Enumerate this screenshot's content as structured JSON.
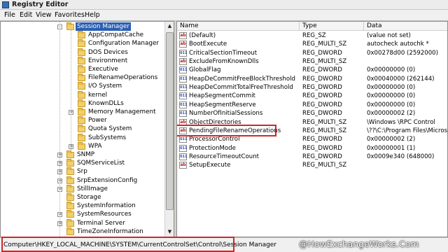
{
  "window": {
    "title": "Registry Editor"
  },
  "menu": [
    "File",
    "Edit",
    "View",
    "Favorites",
    "Help"
  ],
  "tree": {
    "items": [
      {
        "label": "Session Manager",
        "selected": true,
        "expander": "-"
      },
      {
        "label": "AppCompatCache"
      },
      {
        "label": "Configuration Manager"
      },
      {
        "label": "DOS Devices"
      },
      {
        "label": "Environment"
      },
      {
        "label": "Executive"
      },
      {
        "label": "FileRenameOperations"
      },
      {
        "label": "I/O System"
      },
      {
        "label": "kernel"
      },
      {
        "label": "KnownDLLs"
      },
      {
        "label": "Memory Management",
        "expander": "+"
      },
      {
        "label": "Power"
      },
      {
        "label": "Quota System"
      },
      {
        "label": "SubSystems"
      },
      {
        "label": "WPA",
        "expander": "+"
      },
      {
        "label": "SNMP",
        "expander": "+"
      },
      {
        "label": "SQMServiceList",
        "expander": "+"
      },
      {
        "label": "Srp",
        "expander": "+"
      },
      {
        "label": "SrpExtensionConfig",
        "expander": "+"
      },
      {
        "label": "StillImage",
        "expander": "+"
      },
      {
        "label": "Storage"
      },
      {
        "label": "SystemInformation"
      },
      {
        "label": "SystemResources",
        "expander": "+"
      },
      {
        "label": "Terminal Server",
        "expander": "+"
      },
      {
        "label": "TimeZoneInformation"
      }
    ]
  },
  "list": {
    "columns": [
      "Name",
      "Type",
      "Data"
    ],
    "rows": [
      {
        "icon": "sz",
        "name": "(Default)",
        "type": "REG_SZ",
        "data": "(value not set)"
      },
      {
        "icon": "sz",
        "name": "BootExecute",
        "type": "REG_MULTI_SZ",
        "data": "autocheck autochk *"
      },
      {
        "icon": "dw",
        "name": "CriticalSectionTimeout",
        "type": "REG_DWORD",
        "data": "0x00278d00 (2592000)"
      },
      {
        "icon": "sz",
        "name": "ExcludeFromKnownDlls",
        "type": "REG_MULTI_SZ",
        "data": ""
      },
      {
        "icon": "dw",
        "name": "GlobalFlag",
        "type": "REG_DWORD",
        "data": "0x00000000 (0)"
      },
      {
        "icon": "dw",
        "name": "HeapDeCommitFreeBlockThreshold",
        "type": "REG_DWORD",
        "data": "0x00040000 (262144)"
      },
      {
        "icon": "dw",
        "name": "HeapDeCommitTotalFreeThreshold",
        "type": "REG_DWORD",
        "data": "0x00000000 (0)"
      },
      {
        "icon": "dw",
        "name": "HeapSegmentCommit",
        "type": "REG_DWORD",
        "data": "0x00000000 (0)"
      },
      {
        "icon": "dw",
        "name": "HeapSegmentReserve",
        "type": "REG_DWORD",
        "data": "0x00000000 (0)"
      },
      {
        "icon": "dw",
        "name": "NumberOfInitialSessions",
        "type": "REG_DWORD",
        "data": "0x00000002 (2)"
      },
      {
        "icon": "sz",
        "name": "ObjectDirectories",
        "type": "REG_MULTI_SZ",
        "data": "\\Windows \\RPC Control"
      },
      {
        "icon": "sz",
        "name": "PendingFileRenameOperations",
        "type": "REG_MULTI_SZ",
        "data": "\\??\\C:\\Program Files\\Microsoft"
      },
      {
        "icon": "dw",
        "name": "ProcessorControl",
        "type": "REG_DWORD",
        "data": "0x00000002 (2)"
      },
      {
        "icon": "dw",
        "name": "ProtectionMode",
        "type": "REG_DWORD",
        "data": "0x00000001 (1)"
      },
      {
        "icon": "dw",
        "name": "ResourceTimeoutCount",
        "type": "REG_DWORD",
        "data": "0x0009e340 (648000)"
      },
      {
        "icon": "sz",
        "name": "SetupExecute",
        "type": "REG_MULTI_SZ",
        "data": ""
      }
    ]
  },
  "status": {
    "path": "Computer\\HKEY_LOCAL_MACHINE\\SYSTEM\\CurrentControlSet\\Control\\Session Manager"
  },
  "watermark": "@HowExchangeWorks.Com",
  "colors": {
    "selection": "#2b5eb2",
    "highlight_box": "#d0262d",
    "folder": "#f1d06a"
  }
}
